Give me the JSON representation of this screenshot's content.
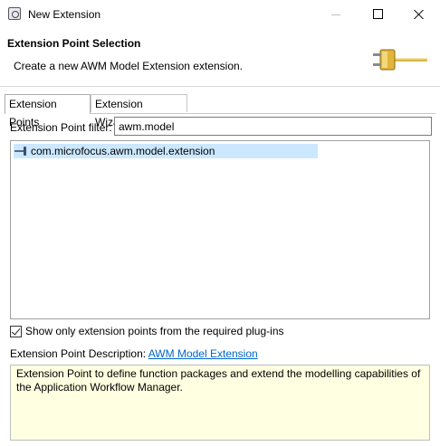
{
  "window": {
    "title": "New Extension"
  },
  "header": {
    "title": "Extension Point Selection",
    "message": "Create a new AWM Model Extension extension."
  },
  "tabs": [
    {
      "label": "Extension Points",
      "active": true
    },
    {
      "label": "Extension Wizards",
      "active": false
    }
  ],
  "filter": {
    "label": "Extension Point filter:",
    "value": "awm.model"
  },
  "extension_list": {
    "items": [
      {
        "label": "com.microfocus.awm.model.extension",
        "selected": true
      }
    ]
  },
  "required_plugins_checkbox": {
    "label": "Show only extension points from the required plug-ins",
    "checked": true
  },
  "description": {
    "label": "Extension Point Description:",
    "link": "AWM Model Extension",
    "text": "Extension Point to define function packages and extend the modelling capabilities of the Application Workflow Manager."
  },
  "colors": {
    "selection": "#cce8ff",
    "description_background": "#ffffe1",
    "link": "#0066cc"
  }
}
